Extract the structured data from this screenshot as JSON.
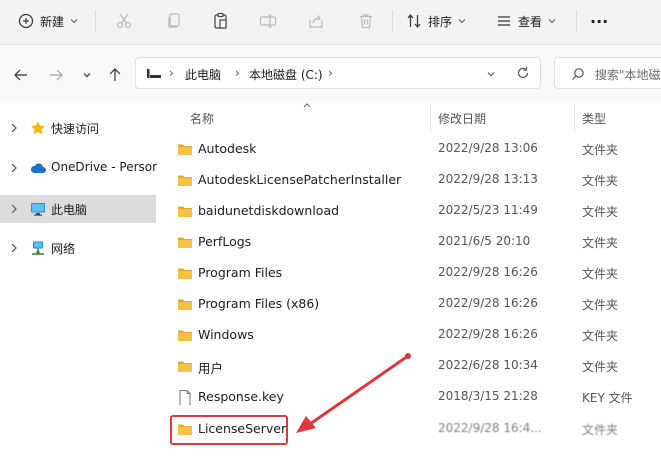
{
  "toolbar": {
    "new_label": "新建",
    "sort_label": "排序",
    "view_label": "查看",
    "more_label": "···"
  },
  "address": {
    "crumbs": [
      "此电脑",
      "本地磁盘 (C:)"
    ],
    "search_placeholder": "搜索\"本地磁"
  },
  "sidebar": {
    "items": [
      {
        "label": "快速访问"
      },
      {
        "label": "OneDrive - Persor"
      },
      {
        "label": "此电脑"
      },
      {
        "label": "网络"
      }
    ]
  },
  "columns": {
    "name": "名称",
    "date": "修改日期",
    "type": "类型"
  },
  "files": [
    {
      "name": "Autodesk",
      "date": "2022/9/28 13:06",
      "type": "文件夹"
    },
    {
      "name": "AutodeskLicensePatcherInstaller",
      "date": "2022/9/28 13:13",
      "type": "文件夹"
    },
    {
      "name": "baidunetdiskdownload",
      "date": "2022/5/23 11:49",
      "type": "文件夹"
    },
    {
      "name": "PerfLogs",
      "date": "2021/6/5 20:10",
      "type": "文件夹"
    },
    {
      "name": "Program Files",
      "date": "2022/9/28 16:26",
      "type": "文件夹"
    },
    {
      "name": "Program Files (x86)",
      "date": "2022/9/28 16:26",
      "type": "文件夹"
    },
    {
      "name": "Windows",
      "date": "2022/9/28 16:26",
      "type": "文件夹"
    },
    {
      "name": "用户",
      "date": "2022/6/28 10:34",
      "type": "文件夹"
    },
    {
      "name": "Response.key",
      "date": "2018/3/15 21:28",
      "type": "KEY 文件"
    },
    {
      "name": "LicenseServer",
      "date": "2022/9/28 16:4...",
      "type": "文件夹"
    }
  ],
  "colors": {
    "annotation": "#e0383e",
    "folder": "#f5c244",
    "selection": "#dcdcdc"
  }
}
